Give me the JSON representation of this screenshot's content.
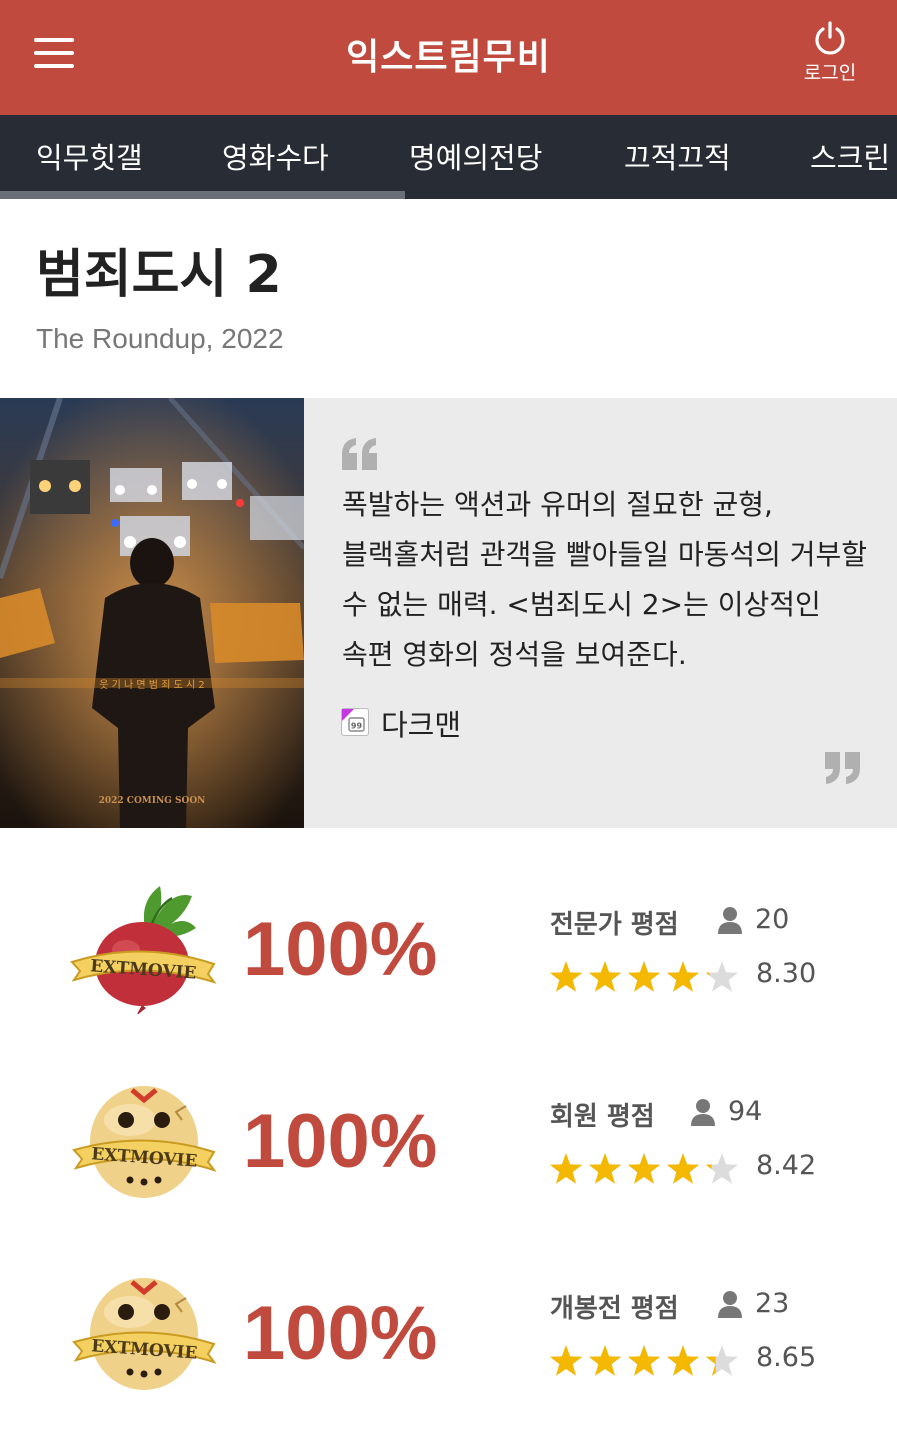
{
  "header": {
    "site_title": "익스트림무비",
    "login_label": "로그인"
  },
  "nav": {
    "tabs": [
      "익무힛갤",
      "영화수다",
      "명예의전당",
      "끄적끄적",
      "스크린"
    ]
  },
  "movie": {
    "title": "범죄도시 2",
    "subtitle": "The Roundup, 2022"
  },
  "poster": {
    "title_overlay": "범죄도시",
    "tagline": "웃 기 나 면   범 죄 도 시 2",
    "release_text": "2022 COMING SOON"
  },
  "review": {
    "text": "폭발하는 액션과 유머의 절묘한 균형, 블랙홀처럼 관객을 빨아들일 마동석의 거부할 수 없는 매력. <범죄도시 2>는 이상적인 속편 영화의 정석을 보여준다.",
    "critic_badge": "99",
    "critic_name": "다크맨"
  },
  "scores": [
    {
      "icon": "radish-icon",
      "badge_text": "EXTMOVIE",
      "percent": "100%",
      "label": "전문가 평점",
      "count": "20",
      "rating": 8.3,
      "rating_text": "8.30"
    },
    {
      "icon": "jason-mask-icon",
      "badge_text": "EXTMOVIE",
      "percent": "100%",
      "label": "회원 평점",
      "count": "94",
      "rating": 8.42,
      "rating_text": "8.42"
    },
    {
      "icon": "jason-mask-icon",
      "badge_text": "EXTMOVIE",
      "percent": "100%",
      "label": "개봉전 평점",
      "count": "23",
      "rating": 8.65,
      "rating_text": "8.65"
    }
  ],
  "colors": {
    "brand": "#c14a3e",
    "nav_bg": "#282c34",
    "star": "#f5b800",
    "star_empty": "#dcdcdc"
  }
}
